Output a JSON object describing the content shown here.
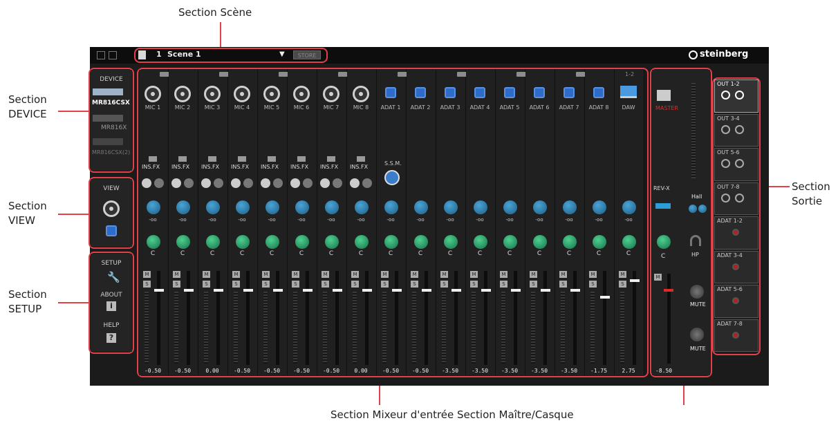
{
  "callouts": {
    "scene": "Section Scène",
    "device": "Section\nDEVICE",
    "view": "Section\nVIEW",
    "setup": "Section\nSETUP",
    "output": "Section\nSortie",
    "bottom": "Section Mixeur d'entrée Section Maître/Casque"
  },
  "topbar": {
    "scene_number": "1",
    "scene_name": "Scene 1",
    "store_label": "STORE",
    "brand": "steinberg"
  },
  "device_panel": {
    "title": "DEVICE",
    "devices": [
      "MR816CSX",
      "MR816X",
      "MR816CSX(2)"
    ]
  },
  "view_panel": {
    "title": "VIEW"
  },
  "setup_panel": {
    "setup": "SETUP",
    "about": "ABOUT",
    "help": "HELP"
  },
  "mixer": {
    "channels": [
      {
        "name": "MIC 1",
        "type": "xlr",
        "insfx": "INS.FX",
        "send": "-oo",
        "pan": "C",
        "fader": "-0.50"
      },
      {
        "name": "MIC 2",
        "type": "xlr",
        "insfx": "INS.FX",
        "send": "-oo",
        "pan": "C",
        "fader": "-0.50"
      },
      {
        "name": "MIC 3",
        "type": "xlr",
        "insfx": "INS.FX",
        "send": "-oo",
        "pan": "C",
        "fader": "0.00"
      },
      {
        "name": "MIC 4",
        "type": "xlr",
        "insfx": "INS.FX",
        "send": "-oo",
        "pan": "C",
        "fader": "-0.50"
      },
      {
        "name": "MIC 5",
        "type": "xlr",
        "insfx": "INS.FX",
        "send": "-oo",
        "pan": "C",
        "fader": "-0.50"
      },
      {
        "name": "MIC 6",
        "type": "xlr",
        "insfx": "INS.FX",
        "send": "-oo",
        "pan": "C",
        "fader": "-0.50"
      },
      {
        "name": "MIC 7",
        "type": "xlr",
        "insfx": "INS.FX",
        "send": "-oo",
        "pan": "C",
        "fader": "-0.50"
      },
      {
        "name": "MIC 8",
        "type": "xlr",
        "insfx": "INS.FX",
        "send": "-oo",
        "pan": "C",
        "fader": "0.00"
      },
      {
        "name": "ADAT 1",
        "type": "adat",
        "send": "-oo",
        "pan": "C",
        "fader": "-0.50"
      },
      {
        "name": "ADAT 2",
        "type": "adat",
        "send": "-oo",
        "pan": "C",
        "fader": "-0.50"
      },
      {
        "name": "ADAT 3",
        "type": "adat",
        "send": "-oo",
        "pan": "C",
        "fader": "-3.50"
      },
      {
        "name": "ADAT 4",
        "type": "adat",
        "send": "-oo",
        "pan": "C",
        "fader": "-3.50"
      },
      {
        "name": "ADAT 5",
        "type": "adat",
        "send": "-oo",
        "pan": "C",
        "fader": "-3.50"
      },
      {
        "name": "ADAT 6",
        "type": "adat",
        "send": "-oo",
        "pan": "C",
        "fader": "-3.50"
      },
      {
        "name": "ADAT 7",
        "type": "adat",
        "send": "-oo",
        "pan": "C",
        "fader": "-3.50"
      },
      {
        "name": "ADAT 8",
        "type": "adat",
        "send": "-oo",
        "pan": "C",
        "fader": "-1.75"
      },
      {
        "name": "DAW",
        "type": "daw",
        "send": "-oo",
        "pan": "C",
        "fader": "2.75"
      }
    ],
    "daw_io": "1-2",
    "ssm_label": "S.S.M."
  },
  "master": {
    "label": "MASTER",
    "reverb": "REV-X",
    "reverb_type": "Hall",
    "pan": "C",
    "fader": "-8.50",
    "hp_label": "HP",
    "mute1": "MUTE",
    "mute2": "MUTE"
  },
  "outputs": [
    {
      "label": "OUT 1-2",
      "kind": "analog"
    },
    {
      "label": "OUT 3-4",
      "kind": "analog"
    },
    {
      "label": "OUT 5-6",
      "kind": "analog"
    },
    {
      "label": "OUT 7-8",
      "kind": "analog"
    },
    {
      "label": "ADAT 1-2",
      "kind": "adat"
    },
    {
      "label": "ADAT 3-4",
      "kind": "adat"
    },
    {
      "label": "ADAT 5-6",
      "kind": "adat"
    },
    {
      "label": "ADAT 7-8",
      "kind": "adat"
    }
  ],
  "colors": {
    "highlight": "#e3404a",
    "master_red": "#e02a2a",
    "send_blue": "#2e82b6",
    "pan_green": "#2fa56b"
  }
}
